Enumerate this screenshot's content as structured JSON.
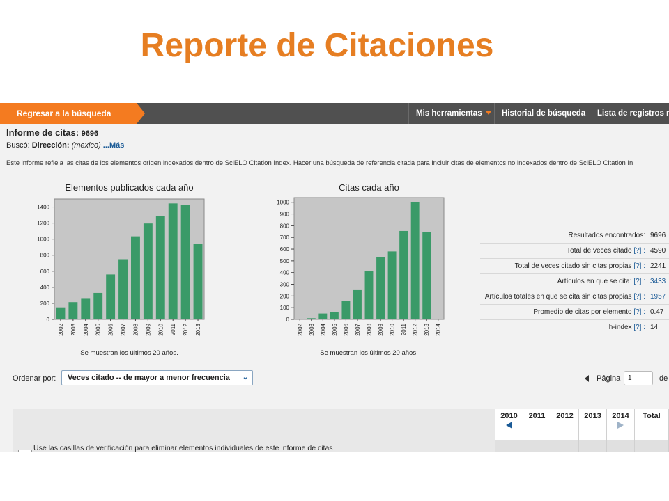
{
  "slide": {
    "title": "Reporte de Citaciones"
  },
  "topbar": {
    "back_label": "Regresar a la búsqueda",
    "menu": [
      "Mis herramientas",
      "Historial de búsqueda",
      "Lista de registros m"
    ]
  },
  "report": {
    "title": "Informe de citas:",
    "count": "9696",
    "search_prefix": "Buscó:",
    "search_field": "Dirección:",
    "search_value": "(mexico)",
    "more_link": "...Más",
    "disclaimer": "Este informe refleja las citas de los elementos origen indexados dentro de SciELO Citation Index. Hacer una búsqueda de referencia citada para incluir citas de elementos no indexados dentro de SciELO Citation In"
  },
  "chart_data": [
    {
      "type": "bar",
      "title": "Elementos publicados cada año",
      "note": "Se muestran los últimos 20 años.",
      "categories": [
        "2002",
        "2003",
        "2004",
        "2005",
        "2006",
        "2007",
        "2008",
        "2009",
        "2010",
        "2011",
        "2012",
        "2013"
      ],
      "values": [
        150,
        215,
        265,
        330,
        560,
        750,
        1035,
        1195,
        1290,
        1445,
        1425,
        940
      ],
      "ylim": [
        0,
        1500
      ],
      "yticks": [
        0,
        200,
        400,
        600,
        800,
        1000,
        1200,
        1400
      ],
      "color": "#3a9a68",
      "grid": false
    },
    {
      "type": "bar",
      "title": "Citas cada año",
      "note": "Se muestran los últimos 20 años.",
      "categories": [
        "2002",
        "2003",
        "2004",
        "2005",
        "2006",
        "2007",
        "2008",
        "2009",
        "2010",
        "2011",
        "2012",
        "2013",
        "2014"
      ],
      "values": [
        0,
        10,
        50,
        65,
        160,
        250,
        410,
        530,
        580,
        755,
        1000,
        745,
        0
      ],
      "ylim": [
        0,
        1040
      ],
      "yticks": [
        0,
        100,
        200,
        300,
        400,
        500,
        600,
        700,
        800,
        900,
        1000
      ],
      "color": "#3a9a68",
      "grid": false
    }
  ],
  "stats": [
    {
      "label": "Resultados encontrados:",
      "help": "",
      "value": "9696",
      "link": false
    },
    {
      "label": "Total de veces citado",
      "help": "[?] :",
      "value": "4590",
      "link": false
    },
    {
      "label": "Total de veces citado sin citas propias",
      "help": "[?] :",
      "value": "2241",
      "link": false
    },
    {
      "label": "Artículos en que se cita:",
      "help": "[?] :",
      "value": "3433",
      "link": true
    },
    {
      "label": "Artículos totales en que se cita sin citas propias",
      "help": "[?] :",
      "value": "1957",
      "link": true
    },
    {
      "label": "Promedio de citas por elemento",
      "help": "[?] :",
      "value": "0.47",
      "link": false
    },
    {
      "label": "h-index",
      "help": "[?] :",
      "value": "14",
      "link": false
    }
  ],
  "sort": {
    "label": "Ordenar por:",
    "selected": "Veces citado -- de mayor a menor frecuencia"
  },
  "pagination": {
    "label": "Página",
    "value": "1",
    "of": "de"
  },
  "table": {
    "years": [
      "2010",
      "2011",
      "2012",
      "2013",
      "2014"
    ],
    "total_label": "Total",
    "checkbox_note": "Use las casillas de verificación para eliminar elementos individuales de este informe de citas"
  }
}
